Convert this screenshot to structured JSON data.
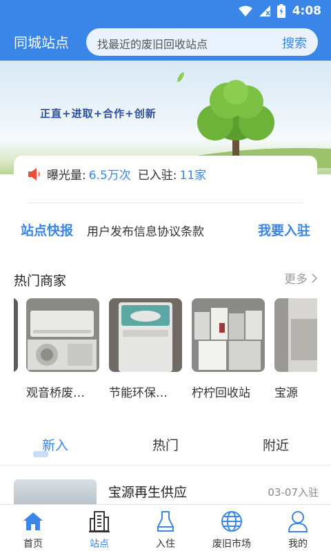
{
  "status_bar": {
    "time": "4:08"
  },
  "header": {
    "title": "同城站点",
    "search_placeholder": "找最近的废旧回收站点",
    "search_button": "搜索"
  },
  "banner": {
    "slogan": "正直+进取+合作+创新"
  },
  "stats": {
    "exposure_label": "曝光量:",
    "exposure_value": "6.5万次",
    "joined_label": "已入驻:",
    "joined_value": "11家"
  },
  "quick": {
    "title": "站点快报",
    "agreement": "用户发布信息协议条款",
    "join": "我要入驻"
  },
  "hot_merchants": {
    "title": "热门商家",
    "more": "更多",
    "items": [
      {
        "name": "观音桥废…"
      },
      {
        "name": "节能环保…"
      },
      {
        "name": "柠柠回收站"
      },
      {
        "name": "宝源"
      }
    ]
  },
  "tabs": [
    {
      "label": "新入"
    },
    {
      "label": "热门"
    },
    {
      "label": "附近"
    }
  ],
  "listing": {
    "name": "宝源再生供应",
    "date": "03-07入驻"
  },
  "bottom_nav": [
    {
      "label": "首页",
      "icon": "home-icon"
    },
    {
      "label": "站点",
      "icon": "building-icon"
    },
    {
      "label": "入住",
      "icon": "checkin-icon"
    },
    {
      "label": "废旧市场",
      "icon": "globe-icon"
    },
    {
      "label": "我的",
      "icon": "user-icon"
    }
  ],
  "colors": {
    "primary": "#3a86e8",
    "search_bg": "#eaf2fd"
  }
}
